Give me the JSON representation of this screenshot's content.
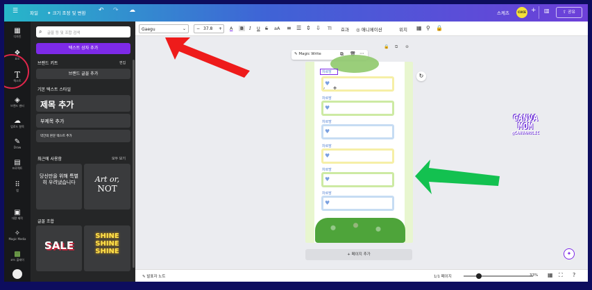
{
  "topbar": {
    "menu_icon": "☰",
    "file": "파일",
    "resize": "✦ 크기 조정 및 변환",
    "share": "공유",
    "user_initials": "CUCE",
    "profile": "스케츠"
  },
  "rail": [
    {
      "label": "디자인",
      "icon": "▦"
    },
    {
      "label": "요소",
      "icon": "❖"
    },
    {
      "label": "텍스트",
      "icon": "T"
    },
    {
      "label": "브랜드 센터",
      "icon": "◈"
    },
    {
      "label": "업로드 항목",
      "icon": "☁"
    },
    {
      "label": "Draw",
      "icon": "✎"
    },
    {
      "label": "프로젝트",
      "icon": "▤"
    },
    {
      "label": "앱",
      "icon": "⠿"
    },
    {
      "label": "대량 제작",
      "icon": "▣"
    },
    {
      "label": "Magic Media",
      "icon": "✧"
    },
    {
      "label": "코드 플레이",
      "icon": "▩"
    }
  ],
  "panel": {
    "search_placeholder": "글꼴 등 및 조합 검색",
    "add_textbox": "텍스트 상자 추가",
    "brand_kit": "브랜드 키트",
    "edit": "편집",
    "add_brand_font": "브랜드 글꼴 추가",
    "default_styles": "기본 텍스트 스타일",
    "add_heading": "제목 추가",
    "add_subheading": "부제목 추가",
    "add_body": "약간의 본문 텍스트 추가",
    "recently_used": "최근에 사용함",
    "see_all": "모두 보기",
    "recent1": "당신만을 위해 특별히 우려냈습니다",
    "recent2_a": "Art or,",
    "recent2_b": "NOT",
    "font_combos": "글꼴 조합",
    "combo1": "SALE",
    "combo2": "SHINE SHINE SHINE"
  },
  "toolbar": {
    "font": "Gaegu",
    "font_size": "37.8",
    "minus": "−",
    "plus": "+",
    "effects": "효과",
    "animate": "애니메이션",
    "position": "위치"
  },
  "canvas": {
    "magic_write": "Magic Write",
    "add_page": "+ 페이지 추가",
    "rows": [
      "차르망",
      "차르망",
      "차르망",
      "차르망",
      "차르망",
      "차르망"
    ],
    "title_text": "차르망",
    "sticker_line1": "CANVA",
    "sticker_line2": "MOM",
    "sticker_line3": "@CANVAHOLIC",
    "arrow_red_color": "#ee1b1b",
    "arrow_green_color": "#13c150"
  },
  "footer": {
    "notes": "발표자 노트",
    "pages": "1/1 페이지",
    "zoom": "33%"
  }
}
